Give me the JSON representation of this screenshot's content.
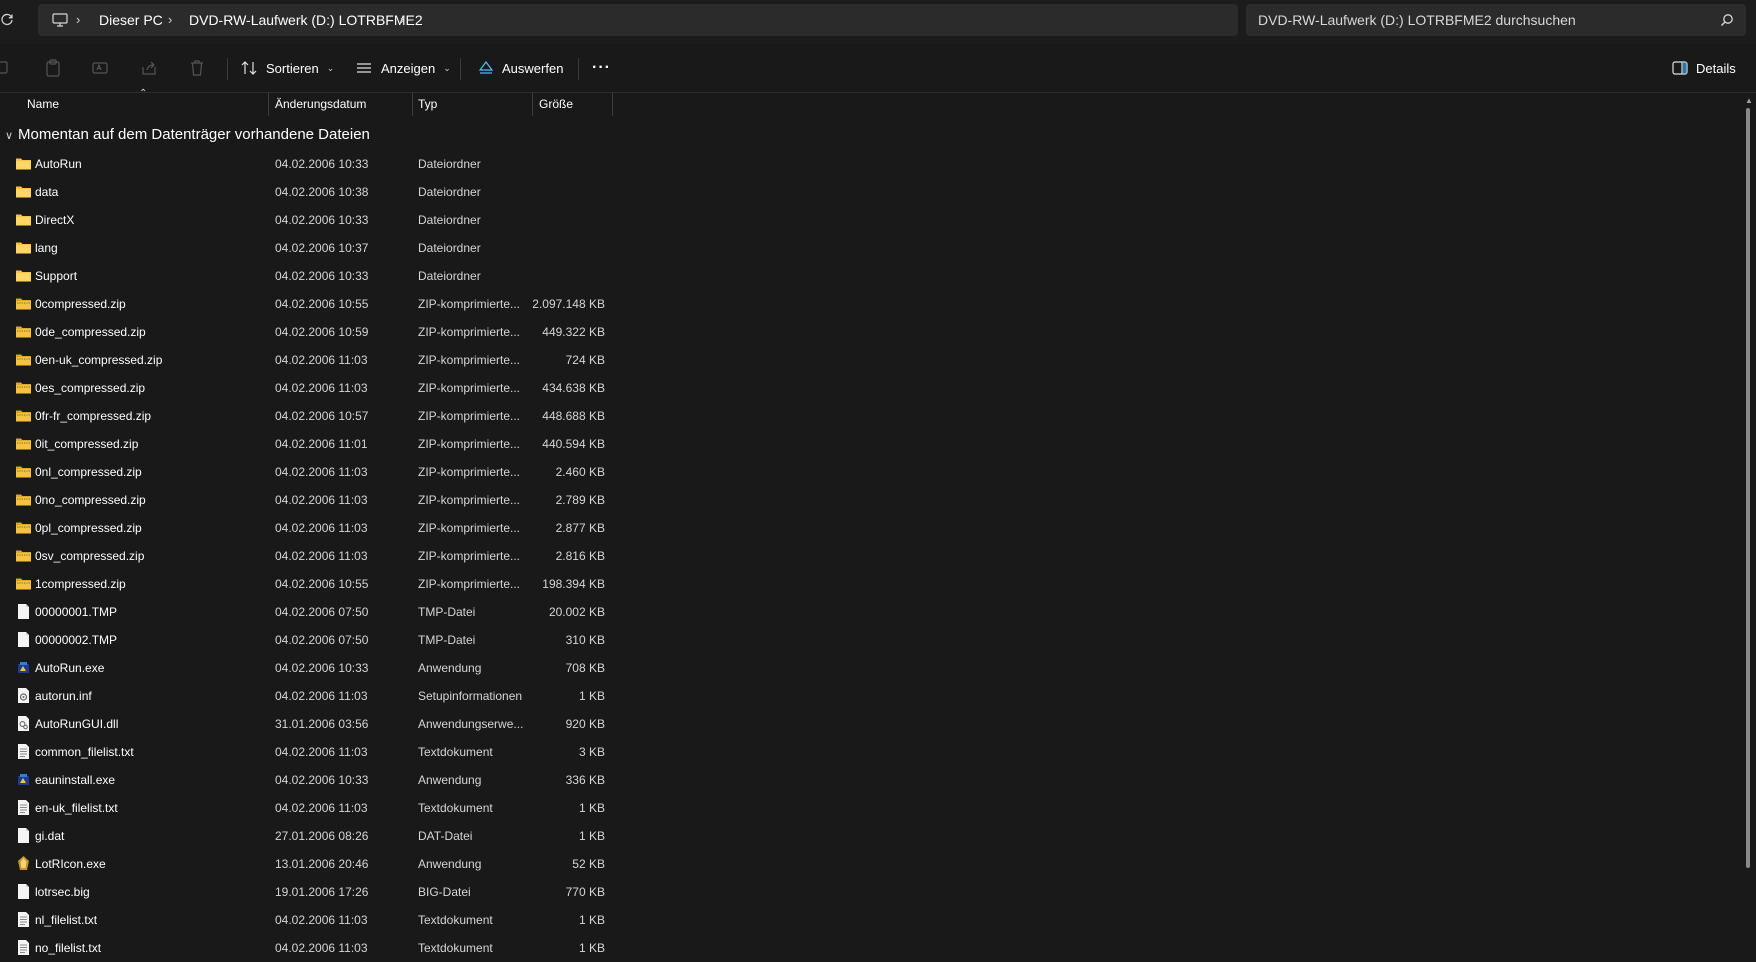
{
  "address_bar": {
    "breadcrumbs": [
      "Dieser PC",
      "DVD-RW-Laufwerk (D:) LOTRBFME2"
    ],
    "search_placeholder": "DVD-RW-Laufwerk (D:) LOTRBFME2 durchsuchen"
  },
  "toolbar": {
    "sort_label": "Sortieren",
    "view_label": "Anzeigen",
    "eject_label": "Auswerfen",
    "more_label": "···",
    "details_label": "Details"
  },
  "columns": {
    "name": "Name",
    "date": "Änderungsdatum",
    "type": "Typ",
    "size": "Größe"
  },
  "group_title": "Momentan auf dem Datenträger vorhandene Dateien",
  "files": [
    {
      "name": "AutoRun",
      "date": "04.02.2006 10:33",
      "type": "Dateiordner",
      "size": "",
      "icon": "folder-icon"
    },
    {
      "name": "data",
      "date": "04.02.2006 10:38",
      "type": "Dateiordner",
      "size": "",
      "icon": "folder-icon"
    },
    {
      "name": "DirectX",
      "date": "04.02.2006 10:33",
      "type": "Dateiordner",
      "size": "",
      "icon": "folder-icon"
    },
    {
      "name": "lang",
      "date": "04.02.2006 10:37",
      "type": "Dateiordner",
      "size": "",
      "icon": "folder-icon"
    },
    {
      "name": "Support",
      "date": "04.02.2006 10:33",
      "type": "Dateiordner",
      "size": "",
      "icon": "folder-icon"
    },
    {
      "name": "0compressed.zip",
      "date": "04.02.2006 10:55",
      "type": "ZIP-komprimierte...",
      "size": "2.097.148 KB",
      "icon": "zip-folder-icon"
    },
    {
      "name": "0de_compressed.zip",
      "date": "04.02.2006 10:59",
      "type": "ZIP-komprimierte...",
      "size": "449.322 KB",
      "icon": "zip-folder-icon"
    },
    {
      "name": "0en-uk_compressed.zip",
      "date": "04.02.2006 11:03",
      "type": "ZIP-komprimierte...",
      "size": "724 KB",
      "icon": "zip-folder-icon"
    },
    {
      "name": "0es_compressed.zip",
      "date": "04.02.2006 11:03",
      "type": "ZIP-komprimierte...",
      "size": "434.638 KB",
      "icon": "zip-folder-icon"
    },
    {
      "name": "0fr-fr_compressed.zip",
      "date": "04.02.2006 10:57",
      "type": "ZIP-komprimierte...",
      "size": "448.688 KB",
      "icon": "zip-folder-icon"
    },
    {
      "name": "0it_compressed.zip",
      "date": "04.02.2006 11:01",
      "type": "ZIP-komprimierte...",
      "size": "440.594 KB",
      "icon": "zip-folder-icon"
    },
    {
      "name": "0nl_compressed.zip",
      "date": "04.02.2006 11:03",
      "type": "ZIP-komprimierte...",
      "size": "2.460 KB",
      "icon": "zip-folder-icon"
    },
    {
      "name": "0no_compressed.zip",
      "date": "04.02.2006 11:03",
      "type": "ZIP-komprimierte...",
      "size": "2.789 KB",
      "icon": "zip-folder-icon"
    },
    {
      "name": "0pl_compressed.zip",
      "date": "04.02.2006 11:03",
      "type": "ZIP-komprimierte...",
      "size": "2.877 KB",
      "icon": "zip-folder-icon"
    },
    {
      "name": "0sv_compressed.zip",
      "date": "04.02.2006 11:03",
      "type": "ZIP-komprimierte...",
      "size": "2.816 KB",
      "icon": "zip-folder-icon"
    },
    {
      "name": "1compressed.zip",
      "date": "04.02.2006 10:55",
      "type": "ZIP-komprimierte...",
      "size": "198.394 KB",
      "icon": "zip-folder-icon"
    },
    {
      "name": "00000001.TMP",
      "date": "04.02.2006 07:50",
      "type": "TMP-Datei",
      "size": "20.002 KB",
      "icon": "file-icon"
    },
    {
      "name": "00000002.TMP",
      "date": "04.02.2006 07:50",
      "type": "TMP-Datei",
      "size": "310 KB",
      "icon": "file-icon"
    },
    {
      "name": "AutoRun.exe",
      "date": "04.02.2006 10:33",
      "type": "Anwendung",
      "size": "708 KB",
      "icon": "application-icon"
    },
    {
      "name": "autorun.inf",
      "date": "04.02.2006 11:03",
      "type": "Setupinformationen",
      "size": "1 KB",
      "icon": "setup-info-icon"
    },
    {
      "name": "AutoRunGUI.dll",
      "date": "31.01.2006 03:56",
      "type": "Anwendungserwe...",
      "size": "920 KB",
      "icon": "dll-icon"
    },
    {
      "name": "common_filelist.txt",
      "date": "04.02.2006 11:03",
      "type": "Textdokument",
      "size": "3 KB",
      "icon": "text-file-icon"
    },
    {
      "name": "eauninstall.exe",
      "date": "04.02.2006 10:33",
      "type": "Anwendung",
      "size": "336 KB",
      "icon": "application-icon"
    },
    {
      "name": "en-uk_filelist.txt",
      "date": "04.02.2006 11:03",
      "type": "Textdokument",
      "size": "1 KB",
      "icon": "text-file-icon"
    },
    {
      "name": "gi.dat",
      "date": "27.01.2006 08:26",
      "type": "DAT-Datei",
      "size": "1 KB",
      "icon": "file-icon"
    },
    {
      "name": "LotRIcon.exe",
      "date": "13.01.2006 20:46",
      "type": "Anwendung",
      "size": "52 KB",
      "icon": "lotr-icon"
    },
    {
      "name": "lotrsec.big",
      "date": "19.01.2006 17:26",
      "type": "BIG-Datei",
      "size": "770 KB",
      "icon": "file-icon"
    },
    {
      "name": "nl_filelist.txt",
      "date": "04.02.2006 11:03",
      "type": "Textdokument",
      "size": "1 KB",
      "icon": "text-file-icon"
    },
    {
      "name": "no_filelist.txt",
      "date": "04.02.2006 11:03",
      "type": "Textdokument",
      "size": "1 KB",
      "icon": "text-file-icon"
    }
  ],
  "colors": {
    "background": "#191919",
    "bar": "#2b2b2b",
    "folder": "#f5c242",
    "accent": "#4cc2ff"
  }
}
